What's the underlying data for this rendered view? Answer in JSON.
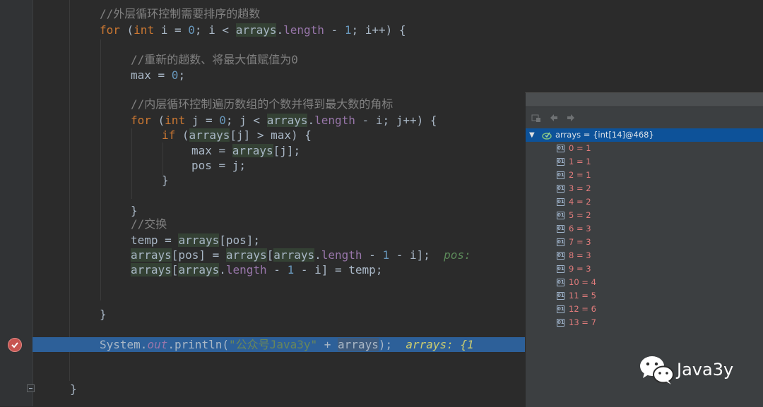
{
  "editor": {
    "lines": [
      {
        "indent": 0,
        "tokens": [
          {
            "t": "//外层循环控制需要排序的趟数",
            "c": "cm"
          }
        ]
      },
      {
        "indent": 0,
        "tokens": [
          {
            "t": "for",
            "c": "kw"
          },
          {
            "t": " (",
            "c": ""
          },
          {
            "t": "int",
            "c": "kw"
          },
          {
            "t": " i = ",
            "c": ""
          },
          {
            "t": "0",
            "c": "num"
          },
          {
            "t": "; i < ",
            "c": ""
          },
          {
            "t": "arrays",
            "c": "var"
          },
          {
            "t": ".",
            "c": ""
          },
          {
            "t": "length",
            "c": "fld"
          },
          {
            "t": " - ",
            "c": ""
          },
          {
            "t": "1",
            "c": "num"
          },
          {
            "t": "; i++) {",
            "c": ""
          }
        ]
      },
      {
        "indent": 1,
        "tokens": [
          {
            "t": "//重新的趟数、将最大值赋值为0",
            "c": "cm"
          }
        ]
      },
      {
        "indent": 1,
        "tokens": [
          {
            "t": "max = ",
            "c": ""
          },
          {
            "t": "0",
            "c": "num"
          },
          {
            "t": ";",
            "c": ""
          }
        ]
      },
      {
        "indent": 1,
        "tokens": [
          {
            "t": "//内层循环控制遍历数组的个数并得到最大数的角标",
            "c": "cm"
          }
        ]
      },
      {
        "indent": 1,
        "tokens": [
          {
            "t": "for",
            "c": "kw"
          },
          {
            "t": " (",
            "c": ""
          },
          {
            "t": "int",
            "c": "kw"
          },
          {
            "t": " j = ",
            "c": ""
          },
          {
            "t": "0",
            "c": "num"
          },
          {
            "t": "; j < ",
            "c": ""
          },
          {
            "t": "arrays",
            "c": "var"
          },
          {
            "t": ".",
            "c": ""
          },
          {
            "t": "length",
            "c": "fld"
          },
          {
            "t": " - i; j++) {",
            "c": ""
          }
        ]
      },
      {
        "indent": 2,
        "tokens": [
          {
            "t": "if",
            "c": "kw"
          },
          {
            "t": " (",
            "c": ""
          },
          {
            "t": "arrays",
            "c": "var"
          },
          {
            "t": "[j] > max) {",
            "c": ""
          }
        ]
      },
      {
        "indent": 3,
        "tokens": [
          {
            "t": "max = ",
            "c": ""
          },
          {
            "t": "arrays",
            "c": "var"
          },
          {
            "t": "[j];",
            "c": ""
          }
        ]
      },
      {
        "indent": 3,
        "tokens": [
          {
            "t": "pos = j;",
            "c": ""
          }
        ]
      },
      {
        "indent": 2,
        "tokens": [
          {
            "t": "}",
            "c": ""
          }
        ]
      },
      {
        "indent": 1,
        "tokens": [
          {
            "t": "}",
            "c": ""
          }
        ]
      },
      {
        "indent": 1,
        "tokens": [
          {
            "t": "//交换",
            "c": "cm"
          }
        ]
      },
      {
        "indent": 1,
        "tokens": [
          {
            "t": "temp = ",
            "c": ""
          },
          {
            "t": "arrays",
            "c": "var"
          },
          {
            "t": "[pos];",
            "c": ""
          }
        ]
      },
      {
        "indent": 1,
        "tokens": [
          {
            "t": "arrays",
            "c": "var"
          },
          {
            "t": "[pos] = ",
            "c": ""
          },
          {
            "t": "arrays",
            "c": "var"
          },
          {
            "t": "[",
            "c": ""
          },
          {
            "t": "arrays",
            "c": "var"
          },
          {
            "t": ".",
            "c": ""
          },
          {
            "t": "length",
            "c": "fld"
          },
          {
            "t": " - ",
            "c": ""
          },
          {
            "t": "1",
            "c": "num"
          },
          {
            "t": " - i];  ",
            "c": ""
          },
          {
            "t": "pos:",
            "c": "inl"
          }
        ]
      },
      {
        "indent": 1,
        "tokens": [
          {
            "t": "arrays",
            "c": "var"
          },
          {
            "t": "[",
            "c": ""
          },
          {
            "t": "arrays",
            "c": "var"
          },
          {
            "t": ".",
            "c": ""
          },
          {
            "t": "length",
            "c": "fld"
          },
          {
            "t": " - ",
            "c": ""
          },
          {
            "t": "1",
            "c": "num"
          },
          {
            "t": " - i] = temp;",
            "c": ""
          }
        ]
      },
      {
        "indent": 0,
        "tokens": [
          {
            "t": "}",
            "c": ""
          }
        ]
      },
      {
        "indent": 0,
        "exec": true,
        "tokens": [
          {
            "t": "System.",
            "c": ""
          },
          {
            "t": "out",
            "c": "sfld"
          },
          {
            "t": ".println(",
            "c": ""
          },
          {
            "t": "\"公众号Java3y\"",
            "c": "str"
          },
          {
            "t": " + ",
            "c": ""
          },
          {
            "t": "arrays",
            "c": "var"
          },
          {
            "t": ");  ",
            "c": ""
          },
          {
            "t": "arrays: {1",
            "c": "inl2"
          }
        ]
      },
      {
        "indent": -1,
        "tokens": [
          {
            "t": "}",
            "c": ""
          }
        ]
      }
    ]
  },
  "debugger": {
    "root_label": "arrays = {int[14]@468}",
    "items": [
      {
        "label": "0 = 1"
      },
      {
        "label": "1 = 1"
      },
      {
        "label": "2 = 1"
      },
      {
        "label": "3 = 2"
      },
      {
        "label": "4 = 2"
      },
      {
        "label": "5 = 2"
      },
      {
        "label": "6 = 3"
      },
      {
        "label": "7 = 3"
      },
      {
        "label": "8 = 3"
      },
      {
        "label": "9 = 3"
      },
      {
        "label": "10 = 4"
      },
      {
        "label": "11 = 5"
      },
      {
        "label": "12 = 6"
      },
      {
        "label": "13 = 7"
      }
    ]
  },
  "watermark": {
    "text": "Java3y"
  },
  "colors": {
    "editor_bg": "#2b2b2b",
    "exec_line": "#2d6099",
    "selected_tree_row": "#0d5299",
    "breakpoint": "#c75450"
  },
  "icons": [
    "breakpoint-check-icon",
    "fold-minus-icon",
    "restore-layout-icon",
    "back-arrow-icon",
    "forward-arrow-icon",
    "expand-arrow-icon",
    "array-field-icon",
    "wechat-logo-icon"
  ]
}
